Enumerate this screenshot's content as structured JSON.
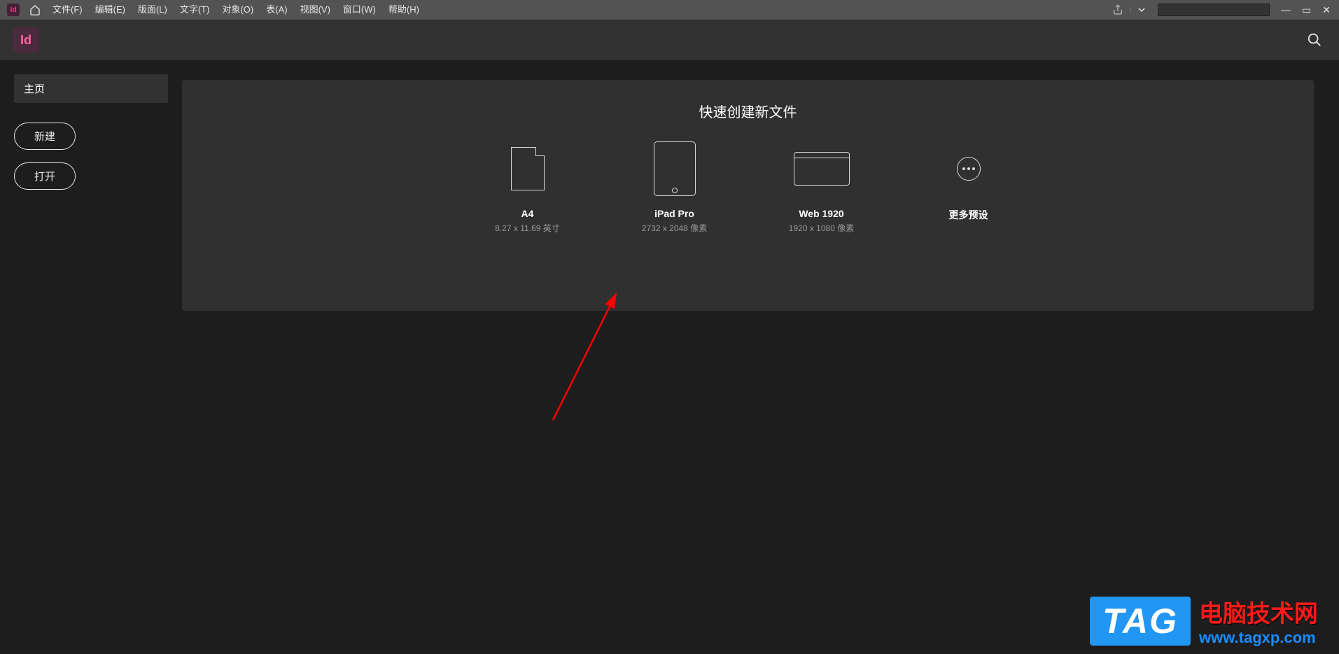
{
  "menubar": {
    "items": [
      "文件(F)",
      "编辑(E)",
      "版面(L)",
      "文字(T)",
      "对象(O)",
      "表(A)",
      "视图(V)",
      "窗口(W)",
      "帮助(H)"
    ]
  },
  "secbar": {
    "badge": "Id"
  },
  "sidebar": {
    "tab": "主页",
    "new_btn": "新建",
    "open_btn": "打开"
  },
  "panel": {
    "title": "快速创建新文件",
    "presets": [
      {
        "name": "A4",
        "dims": "8.27 x 11.69 英寸"
      },
      {
        "name": "iPad Pro",
        "dims": "2732 x 2048 像素"
      },
      {
        "name": "Web 1920",
        "dims": "1920 x 1080 像素"
      },
      {
        "name": "更多预设",
        "dims": ""
      }
    ]
  },
  "watermark": {
    "tag": "TAG",
    "cn": "电脑技术网",
    "url": "www.tagxp.com"
  }
}
